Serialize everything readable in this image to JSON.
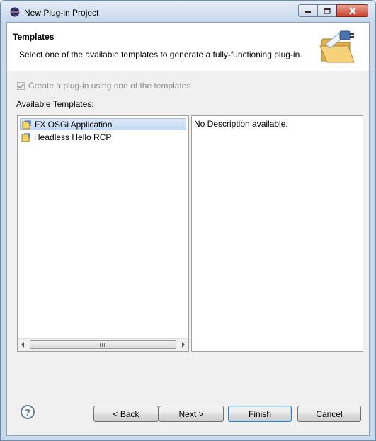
{
  "window": {
    "title": "New Plug-in Project",
    "icon": "eclipse-icon",
    "controls": {
      "minimize": "minimize-icon",
      "maximize": "maximize-icon",
      "close": "close-icon"
    }
  },
  "banner": {
    "title": "Templates",
    "description": "Select one of the available templates to generate a fully-functioning plug-in.",
    "icon": "plugin-folder-icon"
  },
  "checkbox": {
    "label": "Create a plug-in using one of the templates",
    "checked": true,
    "enabled": false
  },
  "templates": {
    "label": "Available Templates:",
    "items": [
      {
        "label": "FX OSGi Application",
        "selected": true,
        "icon": "template-icon"
      },
      {
        "label": "Headless Hello RCP",
        "selected": false,
        "icon": "template-icon"
      }
    ]
  },
  "description_panel": {
    "text": "No Description available."
  },
  "buttons": {
    "back": "< Back",
    "next": "Next >",
    "finish": "Finish",
    "cancel": "Cancel",
    "help": "?"
  },
  "colors": {
    "selection": "#c6daf3",
    "default_button_border": "#3c7fb1",
    "window_frame": "#c9d9ec"
  }
}
